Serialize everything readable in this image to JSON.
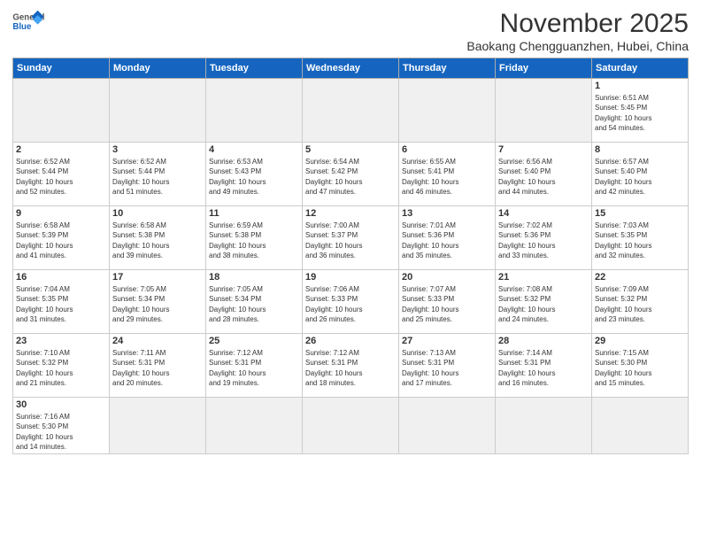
{
  "header": {
    "logo_general": "General",
    "logo_blue": "Blue",
    "month_title": "November 2025",
    "location": "Baokang Chengguanzhen, Hubei, China"
  },
  "weekdays": [
    "Sunday",
    "Monday",
    "Tuesday",
    "Wednesday",
    "Thursday",
    "Friday",
    "Saturday"
  ],
  "days": [
    {
      "num": "",
      "info": ""
    },
    {
      "num": "",
      "info": ""
    },
    {
      "num": "",
      "info": ""
    },
    {
      "num": "",
      "info": ""
    },
    {
      "num": "",
      "info": ""
    },
    {
      "num": "",
      "info": ""
    },
    {
      "num": "1",
      "info": "Sunrise: 6:51 AM\nSunset: 5:45 PM\nDaylight: 10 hours\nand 54 minutes."
    },
    {
      "num": "2",
      "info": "Sunrise: 6:52 AM\nSunset: 5:44 PM\nDaylight: 10 hours\nand 52 minutes."
    },
    {
      "num": "3",
      "info": "Sunrise: 6:52 AM\nSunset: 5:44 PM\nDaylight: 10 hours\nand 51 minutes."
    },
    {
      "num": "4",
      "info": "Sunrise: 6:53 AM\nSunset: 5:43 PM\nDaylight: 10 hours\nand 49 minutes."
    },
    {
      "num": "5",
      "info": "Sunrise: 6:54 AM\nSunset: 5:42 PM\nDaylight: 10 hours\nand 47 minutes."
    },
    {
      "num": "6",
      "info": "Sunrise: 6:55 AM\nSunset: 5:41 PM\nDaylight: 10 hours\nand 46 minutes."
    },
    {
      "num": "7",
      "info": "Sunrise: 6:56 AM\nSunset: 5:40 PM\nDaylight: 10 hours\nand 44 minutes."
    },
    {
      "num": "8",
      "info": "Sunrise: 6:57 AM\nSunset: 5:40 PM\nDaylight: 10 hours\nand 42 minutes."
    },
    {
      "num": "9",
      "info": "Sunrise: 6:58 AM\nSunset: 5:39 PM\nDaylight: 10 hours\nand 41 minutes."
    },
    {
      "num": "10",
      "info": "Sunrise: 6:58 AM\nSunset: 5:38 PM\nDaylight: 10 hours\nand 39 minutes."
    },
    {
      "num": "11",
      "info": "Sunrise: 6:59 AM\nSunset: 5:38 PM\nDaylight: 10 hours\nand 38 minutes."
    },
    {
      "num": "12",
      "info": "Sunrise: 7:00 AM\nSunset: 5:37 PM\nDaylight: 10 hours\nand 36 minutes."
    },
    {
      "num": "13",
      "info": "Sunrise: 7:01 AM\nSunset: 5:36 PM\nDaylight: 10 hours\nand 35 minutes."
    },
    {
      "num": "14",
      "info": "Sunrise: 7:02 AM\nSunset: 5:36 PM\nDaylight: 10 hours\nand 33 minutes."
    },
    {
      "num": "15",
      "info": "Sunrise: 7:03 AM\nSunset: 5:35 PM\nDaylight: 10 hours\nand 32 minutes."
    },
    {
      "num": "16",
      "info": "Sunrise: 7:04 AM\nSunset: 5:35 PM\nDaylight: 10 hours\nand 31 minutes."
    },
    {
      "num": "17",
      "info": "Sunrise: 7:05 AM\nSunset: 5:34 PM\nDaylight: 10 hours\nand 29 minutes."
    },
    {
      "num": "18",
      "info": "Sunrise: 7:05 AM\nSunset: 5:34 PM\nDaylight: 10 hours\nand 28 minutes."
    },
    {
      "num": "19",
      "info": "Sunrise: 7:06 AM\nSunset: 5:33 PM\nDaylight: 10 hours\nand 26 minutes."
    },
    {
      "num": "20",
      "info": "Sunrise: 7:07 AM\nSunset: 5:33 PM\nDaylight: 10 hours\nand 25 minutes."
    },
    {
      "num": "21",
      "info": "Sunrise: 7:08 AM\nSunset: 5:32 PM\nDaylight: 10 hours\nand 24 minutes."
    },
    {
      "num": "22",
      "info": "Sunrise: 7:09 AM\nSunset: 5:32 PM\nDaylight: 10 hours\nand 23 minutes."
    },
    {
      "num": "23",
      "info": "Sunrise: 7:10 AM\nSunset: 5:32 PM\nDaylight: 10 hours\nand 21 minutes."
    },
    {
      "num": "24",
      "info": "Sunrise: 7:11 AM\nSunset: 5:31 PM\nDaylight: 10 hours\nand 20 minutes."
    },
    {
      "num": "25",
      "info": "Sunrise: 7:12 AM\nSunset: 5:31 PM\nDaylight: 10 hours\nand 19 minutes."
    },
    {
      "num": "26",
      "info": "Sunrise: 7:12 AM\nSunset: 5:31 PM\nDaylight: 10 hours\nand 18 minutes."
    },
    {
      "num": "27",
      "info": "Sunrise: 7:13 AM\nSunset: 5:31 PM\nDaylight: 10 hours\nand 17 minutes."
    },
    {
      "num": "28",
      "info": "Sunrise: 7:14 AM\nSunset: 5:31 PM\nDaylight: 10 hours\nand 16 minutes."
    },
    {
      "num": "29",
      "info": "Sunrise: 7:15 AM\nSunset: 5:30 PM\nDaylight: 10 hours\nand 15 minutes."
    },
    {
      "num": "30",
      "info": "Sunrise: 7:16 AM\nSunset: 5:30 PM\nDaylight: 10 hours\nand 14 minutes."
    },
    {
      "num": "",
      "info": ""
    },
    {
      "num": "",
      "info": ""
    },
    {
      "num": "",
      "info": ""
    },
    {
      "num": "",
      "info": ""
    },
    {
      "num": "",
      "info": ""
    },
    {
      "num": "",
      "info": ""
    }
  ]
}
